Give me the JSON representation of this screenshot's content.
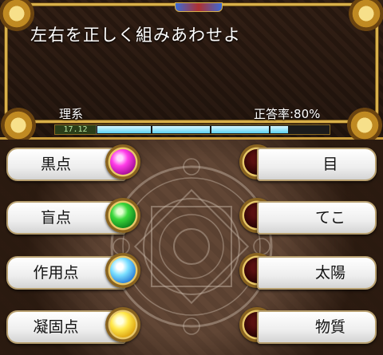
{
  "question": {
    "text": "左右を正しく組みあわせよ",
    "genre": "理系",
    "accuracy": "正答率:80%"
  },
  "timer": {
    "text": "17.12",
    "fill_fraction": 0.82
  },
  "left_items": [
    {
      "label": "黒点",
      "orb_color": "magenta"
    },
    {
      "label": "盲点",
      "orb_color": "green"
    },
    {
      "label": "作用点",
      "orb_color": "blue"
    },
    {
      "label": "凝固点",
      "orb_color": "yellow"
    }
  ],
  "right_items": [
    {
      "label": "目"
    },
    {
      "label": "てこ"
    },
    {
      "label": "太陽"
    },
    {
      "label": "物質"
    }
  ],
  "colors": {
    "frame_gold": "#d8b04a",
    "timer_fill": "#5fd2f2",
    "empty_orb": "#2a0404"
  }
}
